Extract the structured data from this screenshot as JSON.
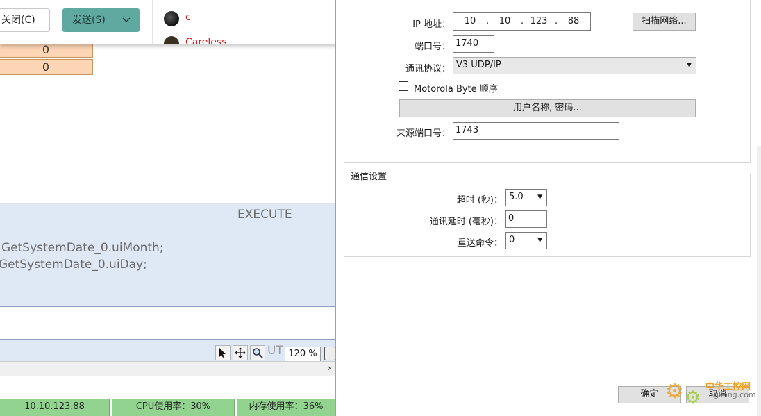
{
  "popup": {
    "close_label": "关闭(C)",
    "send_label": "发送(S)",
    "contacts": [
      {
        "name": "c"
      },
      {
        "name": "Careless"
      }
    ]
  },
  "background_app": {
    "cells": [
      "0",
      "0"
    ],
    "code_label": "EXECUTE",
    "code_lines": [
      "GetSystemDate_0.uiMonth;",
      "GetSystemDate_0.uiDay;"
    ],
    "toolbar_text": "UT",
    "zoom": "120 %",
    "status": {
      "ip": "10.10.123.88",
      "cpu": "CPU使用率：30%",
      "mem": "内存使用率：36%"
    }
  },
  "dialog": {
    "ip_label": "IP 地址：",
    "ip_parts": [
      "10",
      "10",
      "123",
      "88"
    ],
    "scan_button": "扫描网络...",
    "port_label": "端口号：",
    "port_value": "1740",
    "protocol_label": "通讯协议：",
    "protocol_value": "V3 UDP/IP",
    "motorola_label": "Motorola Byte 顺序",
    "credentials_button": "用户名称, 密码...",
    "source_port_label": "来源端口号：",
    "source_port_value": "1743",
    "comm_group_title": "通信设置",
    "timeout_label": "超时 (秒)：",
    "timeout_value": "5.0",
    "delay_label": "通讯延时 (毫秒)：",
    "delay_value": "0",
    "resend_label": "重送命令：",
    "resend_value": "0",
    "ok_button": "确定",
    "cancel_button": "取消"
  },
  "watermark": {
    "text": "中华工控网",
    "sub": "gkong.com"
  },
  "colors": {
    "accent_send": "#5fa9a0",
    "status_green": "#92d48f",
    "cell_orange": "#fcd5b4"
  }
}
